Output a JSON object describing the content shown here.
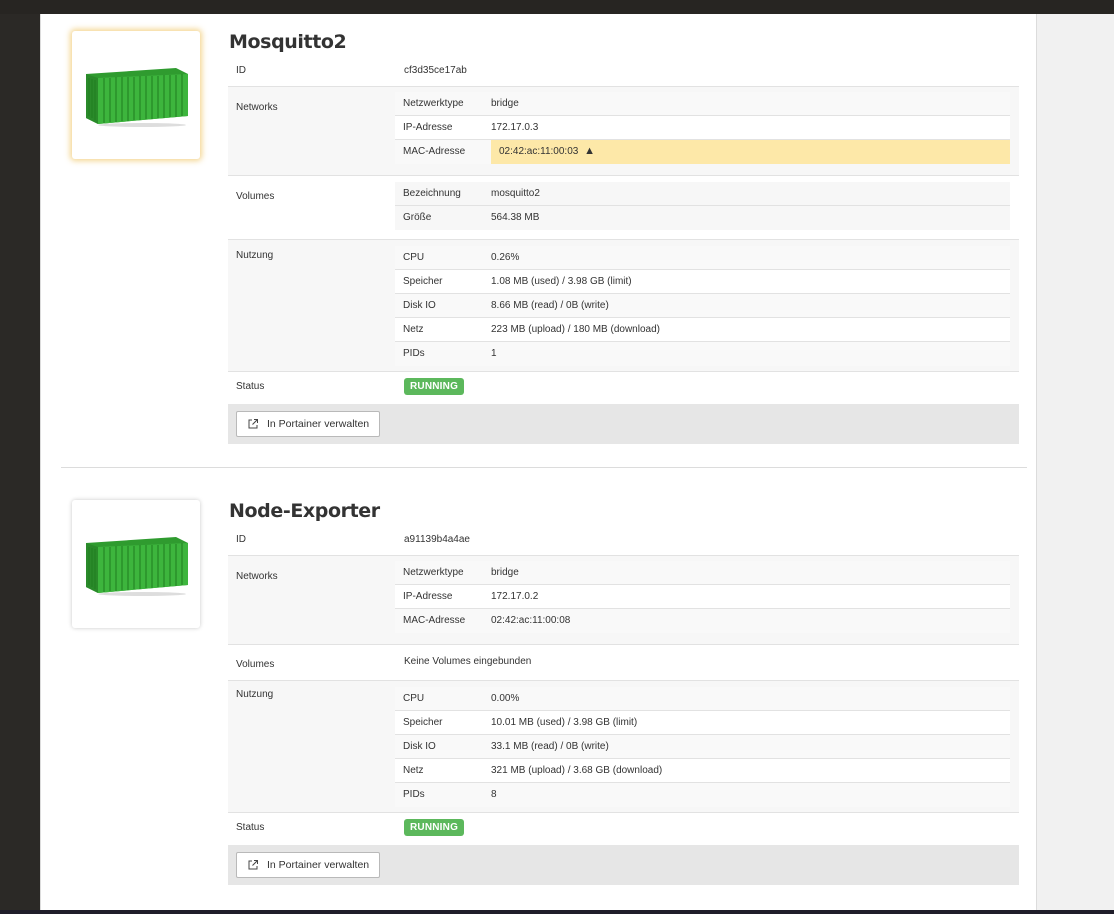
{
  "containers": [
    {
      "name": "Mosquitto2",
      "id_label": "ID",
      "id": "cf3d35ce17ab",
      "networks_label": "Networks",
      "networks": [
        {
          "key": "Netzwerktype",
          "value": "bridge"
        },
        {
          "key": "IP-Adresse",
          "value": "172.17.0.3"
        },
        {
          "key": "MAC-Adresse",
          "value": "02:42:ac:11:00:03",
          "warning": true
        }
      ],
      "volumes_label": "Volumes",
      "volumes": [
        {
          "key": "Bezeichnung",
          "value": "mosquitto2"
        },
        {
          "key": "Größe",
          "value": "564.38 MB"
        }
      ],
      "usage_label": "Nutzung",
      "usage": [
        {
          "key": "CPU",
          "value": "0.26%"
        },
        {
          "key": "Speicher",
          "value": "1.08 MB (used) / 3.98 GB (limit)"
        },
        {
          "key": "Disk IO",
          "value": "8.66 MB (read) / 0B (write)"
        },
        {
          "key": "Netz",
          "value": "223 MB (upload) / 180 MB (download)"
        },
        {
          "key": "PIDs",
          "value": "1"
        }
      ],
      "status_label": "Status",
      "status": "RUNNING",
      "action_label": "In Portainer verwalten"
    },
    {
      "name": "Node-Exporter",
      "id_label": "ID",
      "id": "a91139b4a4ae",
      "networks_label": "Networks",
      "networks": [
        {
          "key": "Netzwerktype",
          "value": "bridge"
        },
        {
          "key": "IP-Adresse",
          "value": "172.17.0.2"
        },
        {
          "key": "MAC-Adresse",
          "value": "02:42:ac:11:00:08"
        }
      ],
      "volumes_label": "Volumes",
      "volumes_empty": "Keine Volumes eingebunden",
      "usage_label": "Nutzung",
      "usage": [
        {
          "key": "CPU",
          "value": "0.00%"
        },
        {
          "key": "Speicher",
          "value": "10.01 MB (used) / 3.98 GB (limit)"
        },
        {
          "key": "Disk IO",
          "value": "33.1 MB (read) / 0B (write)"
        },
        {
          "key": "Netz",
          "value": "321 MB (upload) / 3.68 GB (download)"
        },
        {
          "key": "PIDs",
          "value": "8"
        }
      ],
      "status_label": "Status",
      "status": "RUNNING",
      "action_label": "In Portainer verwalten"
    }
  ],
  "colors": {
    "running": "#5cb85c",
    "warning_row": "#fde8a8",
    "container_green": "#3db53d"
  },
  "icons": {
    "thumbnail": "shipping-container-icon",
    "warning": "warning-triangle-icon",
    "external": "external-link-icon"
  }
}
